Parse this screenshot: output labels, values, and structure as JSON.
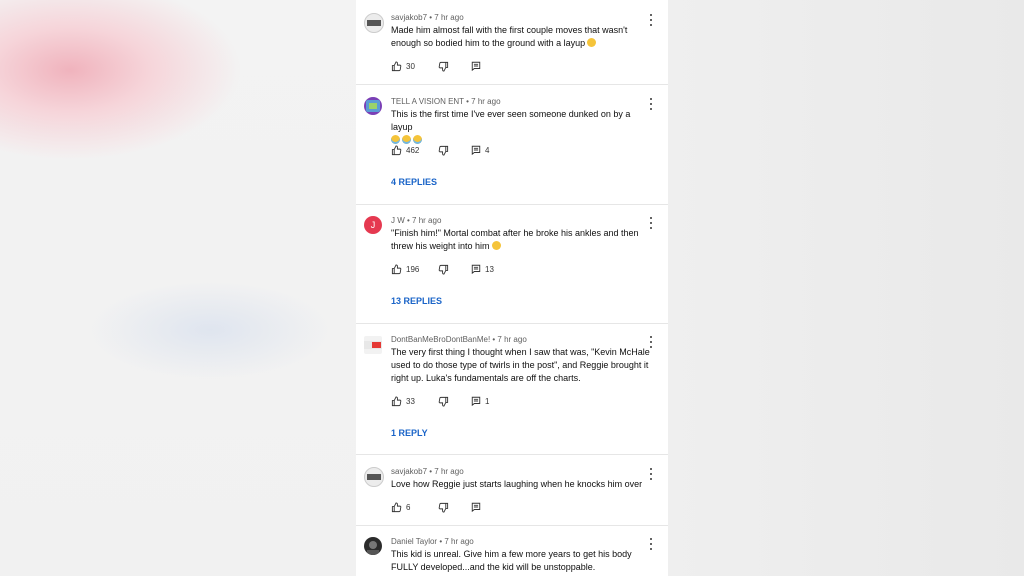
{
  "comments": [
    {
      "author": "savjakob7",
      "time": "7 hr ago",
      "text": "Made him almost fall with the first couple moves that wasn't enough so bodied him to the ground with a layup",
      "emojis": [
        "😂"
      ],
      "likes": "30",
      "reply_count": "",
      "replies_label": "",
      "avatar_color": "#e8e8e8"
    },
    {
      "author": "TELL A VISION ENT",
      "time": "7 hr ago",
      "text": "This is the first time I've ever seen someone dunked on by a layup",
      "emojis": [
        "😭",
        "😭",
        "😭"
      ],
      "likes": "462",
      "reply_count": "4",
      "replies_label": "4 REPLIES",
      "avatar_color": "#7a3fb5"
    },
    {
      "author": "J W",
      "time": "7 hr ago",
      "text": "\"Finish him!\" Mortal combat after he broke his ankles and then threw his weight into him",
      "emojis": [
        "😄"
      ],
      "likes": "196",
      "reply_count": "13",
      "replies_label": "13 REPLIES",
      "avatar_letter": "J",
      "avatar_color": "#e53950"
    },
    {
      "author": "DontBanMeBroDontBanMe!",
      "time": "7 hr ago",
      "text": "The very first thing I thought when I saw that was, \"Kevin McHale used to do those type of twirls in the post\", and Reggie brought it right up. Luka's fundamentals are off the charts.",
      "emojis": [],
      "likes": "33",
      "reply_count": "1",
      "replies_label": "1 REPLY",
      "avatar_color": "#f2f2f2"
    },
    {
      "author": "savjakob7",
      "time": "7 hr ago",
      "text": "Love how Reggie just starts laughing when he knocks him over",
      "emojis": [],
      "likes": "6",
      "reply_count": "",
      "replies_label": "",
      "avatar_color": "#e8e8e8"
    },
    {
      "author": "Daniel Taylor",
      "time": "7 hr ago",
      "text": "This kid is unreal.  Give him a few more years to get his body FULLY developed...and the kid will be unstoppable.",
      "emojis": [],
      "likes": "",
      "reply_count": "",
      "replies_label": "",
      "avatar_color": "#2b2b2b"
    }
  ],
  "colors": {
    "link": "#1a64c8",
    "meta": "#606060",
    "text": "#0f0f0f"
  },
  "icons": [
    "thumbs-up-icon",
    "thumbs-down-icon",
    "reply-icon",
    "more-vert-icon"
  ]
}
